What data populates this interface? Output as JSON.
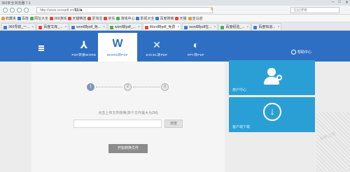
{
  "browser": {
    "title": "360安全浏览器 7.1",
    "window_controls": [
      "–",
      "□",
      "✕"
    ],
    "url_prefix": "http://www.xxxxpdf.cn/",
    "url_domain": "53.la",
    "search_placeholder": "在此搜索"
  },
  "bookmarks": [
    {
      "label": "收藏夹",
      "color": "#d9a441"
    },
    {
      "label": "百度",
      "color": "#3a7bd5"
    },
    {
      "label": "网址大全",
      "color": "#4caf50"
    },
    {
      "label": "360游戏",
      "color": "#e0463b"
    },
    {
      "label": "天猫精选",
      "color": "#e0463b"
    },
    {
      "label": "爱淘宝",
      "color": "#e0463b"
    },
    {
      "label": "京东",
      "color": "#e0463b"
    },
    {
      "label": "游戏中心",
      "color": "#4caf50"
    },
    {
      "label": "影视大全",
      "color": "#3a7bd5"
    },
    {
      "label": "百度搜索",
      "color": "#3a7bd5"
    },
    {
      "label": "天猫",
      "color": "#e0463b"
    },
    {
      "label": "亚马逊",
      "color": "#d9a441"
    }
  ],
  "tabs": [
    {
      "label": "360导航_一..."
    },
    {
      "label": "百度文库_..."
    },
    {
      "label": "word转pdf_免..."
    },
    {
      "label": "word转pdf_..."
    },
    {
      "label": "Word转pdf_免费",
      "active": true
    },
    {
      "label": "word转pdf在..."
    },
    {
      "label": "百度经验_..."
    },
    {
      "label": "百度知道..."
    }
  ],
  "site": {
    "tools": [
      {
        "glyph": "⅄",
        "label": "PDF转换WORD"
      },
      {
        "glyph": "W",
        "label": "WORD转PDF",
        "active": true
      },
      {
        "glyph": "✕",
        "label": "EXCEL转PDF"
      },
      {
        "glyph": "◐",
        "label": "PPT转PDF"
      }
    ],
    "help": "帮助中心"
  },
  "converter": {
    "steps": [
      "1",
      "2",
      "3"
    ],
    "hint": "点击上传文件转换(单个文件最大为2M)",
    "file_placeholder": "",
    "browse": "浏览",
    "convert": "开始转换文件"
  },
  "cards": {
    "user_center": "用户中心",
    "download": "客户端下载"
  },
  "watermark": "系统之家",
  "colors": {
    "brand_blue": "#2f6fc3",
    "card_blue": "#2a9fd6",
    "step_active": "#7f98b8",
    "button_gray": "#8c8c8c"
  }
}
